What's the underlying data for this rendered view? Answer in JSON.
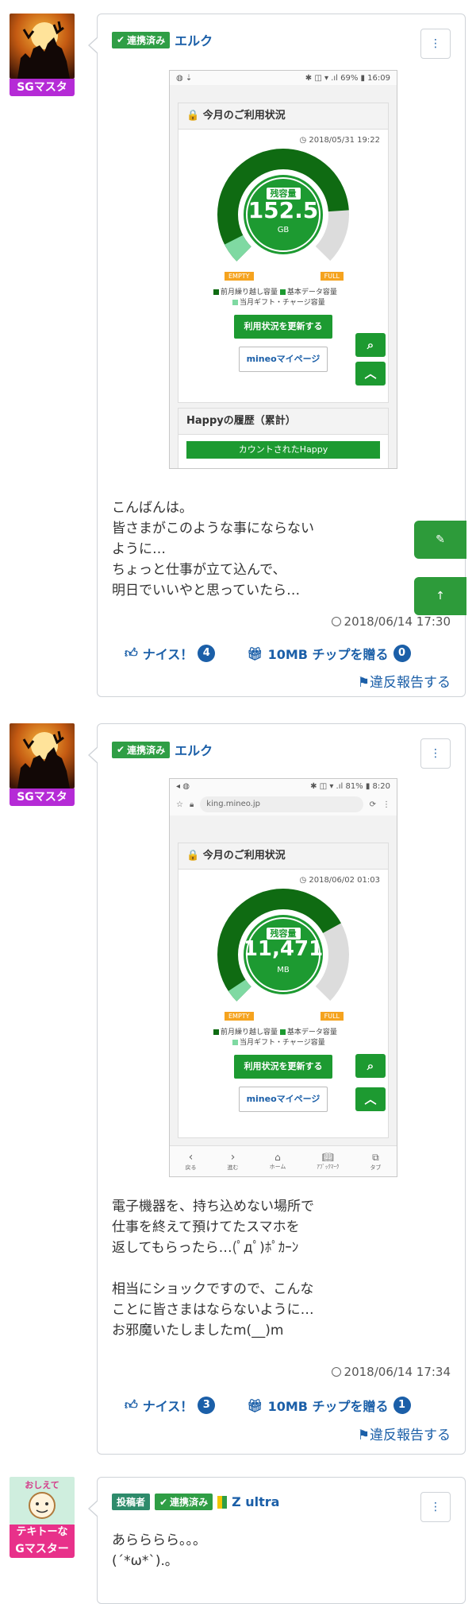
{
  "posts": [
    {
      "user_rank": "SGマスタ",
      "badges": [
        "連携済み"
      ],
      "username": "エルク",
      "screenshot": {
        "statusbar_left": "◍ ⇣",
        "statusbar_right": "✱ ◫ ▾ .ıl 69% ▮ 16:09",
        "panel_title": "今月のご利用状況",
        "timestamp": "2018/05/31 19:22",
        "gauge_label": "残容量",
        "gauge_value": "152.5",
        "gauge_unit": "GB",
        "empty_label": "EMPTY",
        "full_label": "FULL",
        "legend": [
          "前月繰り越し容量",
          "基本データ容量",
          "当月ギフト・チャージ容量"
        ],
        "update_button": "利用状況を更新する",
        "mypage_button": "mineoマイページ",
        "history_title": "Happyの履歴（累計）",
        "history_button": "カウントされたHappy"
      },
      "body": "こんばんは。\n皆さまがこのような事にならない\nように…\nちょっと仕事が立て込んで、\n明日でいいやと思っていたら…",
      "posted_at": "2018/06/14 17:30",
      "nice_label": "ナイス！",
      "nice_count": "4",
      "chip_label": "10MB チップを贈る",
      "chip_count": "0",
      "report_label": "違反報告する"
    },
    {
      "user_rank": "SGマスタ",
      "badges": [
        "連携済み"
      ],
      "username": "エルク",
      "screenshot": {
        "statusbar_left": "◂ ◍",
        "statusbar_right": "✱ ◫ ▾ .ıl 81% ▮ 8:20",
        "url": "king.mineo.jp",
        "panel_title": "今月のご利用状況",
        "timestamp": "2018/06/02 01:03",
        "gauge_label": "残容量",
        "gauge_value": "11,471",
        "gauge_unit": "MB",
        "empty_label": "EMPTY",
        "full_label": "FULL",
        "legend": [
          "前月繰り越し容量",
          "基本データ容量",
          "当月ギフト・チャージ容量"
        ],
        "update_button": "利用状況を更新する",
        "mypage_button": "mineoマイページ",
        "nav": [
          "戻る",
          "進む",
          "ホーム",
          "ｱﾌﾞｯｸﾏｰｸ",
          "タブ"
        ]
      },
      "body": "電子機器を、持ち込めない場所で\n仕事を終えて預けてたスマホを\n返してもらったら…(ﾟдﾟ)ﾎﾟｶｰﾝ\n\n相当にショックですので、こんな\nことに皆さまはならないように…\nお邪魔いたしましたm(__)m",
      "posted_at": "2018/06/14 17:34",
      "nice_label": "ナイス！",
      "nice_count": "3",
      "chip_label": "10MB チップを贈る",
      "chip_count": "1",
      "report_label": "違反報告する"
    },
    {
      "avatar_caption_top": "おしえて",
      "avatar_caption": "テキトーな",
      "user_rank": "Gマスター",
      "badges": [
        "投稿者",
        "連携済み"
      ],
      "username": "Z ultra",
      "body": "あらららら。。。\n(´*ω*`).｡"
    }
  ],
  "colors": {
    "accent_blue": "#1b5fa8",
    "green": "#1d9a31",
    "rank_purple": "#b52bd6"
  }
}
